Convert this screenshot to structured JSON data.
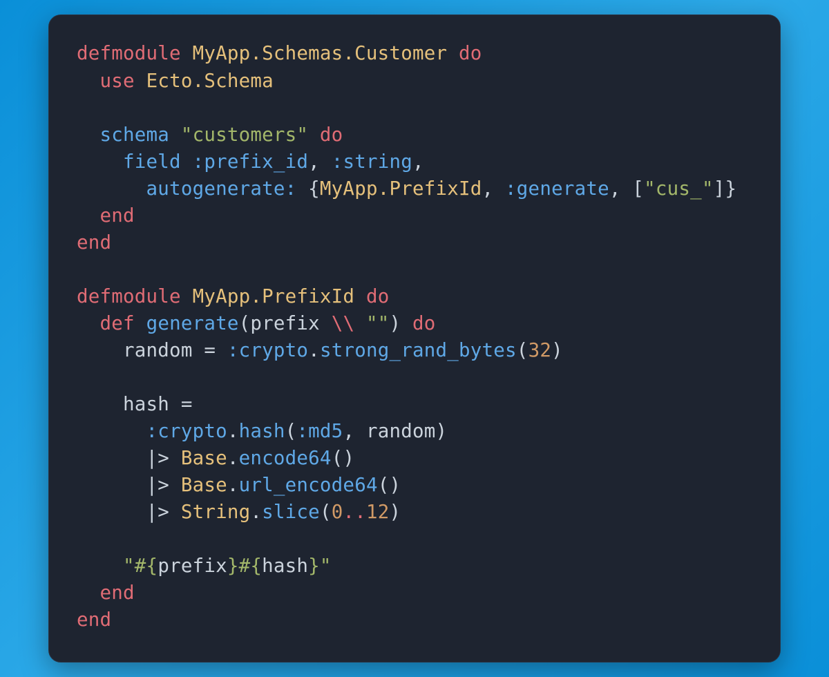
{
  "syntax": {
    "kw_defmodule": "defmodule",
    "kw_do": "do",
    "kw_end": "end",
    "kw_use": "use",
    "kw_def": "def",
    "mod_customer": "MyApp.Schemas.Customer",
    "mod_ecto_schema": "Ecto.Schema",
    "mod_prefixid": "MyApp.PrefixId",
    "mod_base": "Base",
    "mod_string": "String",
    "fn_schema": "schema",
    "fn_field": "field",
    "fn_generate": "generate",
    "fn_strong_rand_bytes": "strong_rand_bytes",
    "fn_hash": "hash",
    "fn_encode64": "encode64",
    "fn_url_encode64": "url_encode64",
    "fn_slice": "slice",
    "atom_prefix_id": ":prefix_id",
    "atom_string": ":string",
    "atom_generate": ":generate",
    "atom_crypto": ":crypto",
    "atom_md5": ":md5",
    "key_autogenerate": "autogenerate:",
    "str_customers": "\"customers\"",
    "str_cus": "\"cus_\"",
    "str_empty": "\"\"",
    "str_interp_open1": "\"#{",
    "str_interp_mid": "}#{",
    "str_interp_close": "}\"",
    "var_prefix": "prefix",
    "var_random": "random",
    "var_hash": "hash",
    "op_default": "\\\\",
    "op_eq": "=",
    "op_pipe": "|>",
    "num_32": "32",
    "num_0": "0",
    "num_12": "12",
    "punct_dot": ".",
    "punct_comma": ",",
    "punct_lparen": "(",
    "punct_rparen": ")",
    "punct_lbrace": "{",
    "punct_rbrace": "}",
    "punct_lbracket": "[",
    "punct_rbracket": "]",
    "punct_range": ".."
  }
}
